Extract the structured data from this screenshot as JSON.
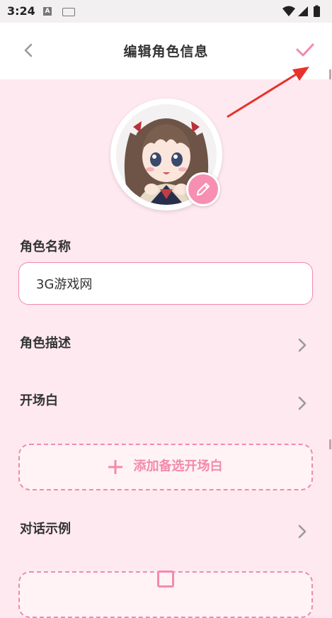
{
  "status_bar": {
    "time": "3:24",
    "notif_a": "A"
  },
  "header": {
    "title": "编辑角色信息"
  },
  "form": {
    "name_label": "角色名称",
    "name_value": "3G游戏网",
    "description_label": "角色描述",
    "opening_label": "开场白",
    "add_opening_label": "添加备选开场白",
    "dialogue_example_label": "对话示例"
  },
  "colors": {
    "accent": "#f38aac",
    "background": "#fde9ef",
    "annotation": "#e8322b"
  }
}
